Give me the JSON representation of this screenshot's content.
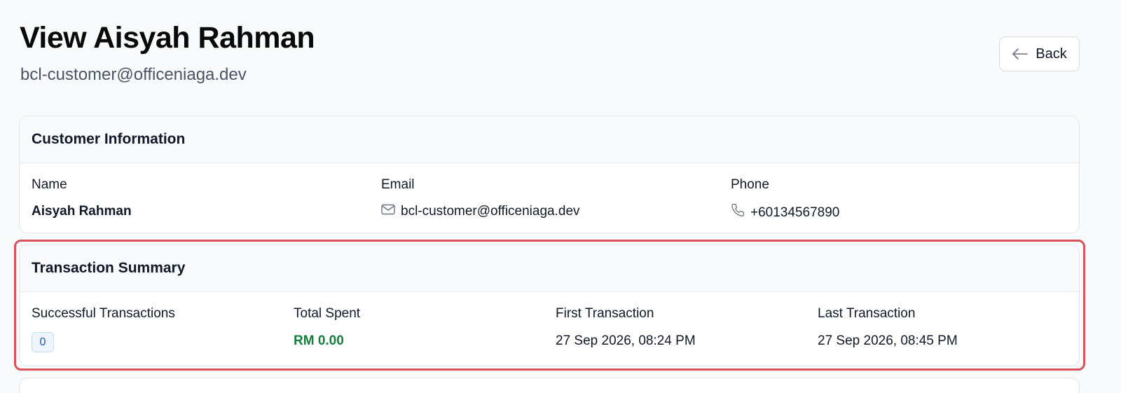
{
  "header": {
    "title": "View Aisyah Rahman",
    "subtitle": "bcl-customer@officeniaga.dev",
    "back_label": "Back"
  },
  "customer_info": {
    "heading": "Customer Information",
    "name_label": "Name",
    "name_value": "Aisyah Rahman",
    "email_label": "Email",
    "email_value": "bcl-customer@officeniaga.dev",
    "phone_label": "Phone",
    "phone_value": "+60134567890"
  },
  "transaction_summary": {
    "heading": "Transaction Summary",
    "successful_label": "Successful Transactions",
    "successful_value": "0",
    "total_label": "Total Spent",
    "total_value": "RM 0.00",
    "first_label": "First Transaction",
    "first_value": "27 Sep 2026, 08:24 PM",
    "last_label": "Last Transaction",
    "last_value": "27 Sep 2026, 08:45 PM"
  },
  "colors": {
    "accent_green": "#15803d",
    "badge_blue": "#1e56c4",
    "highlight_red": "#d9525a"
  },
  "icons": {
    "back": "arrow-left-icon",
    "email": "mail-icon",
    "phone": "phone-icon"
  }
}
